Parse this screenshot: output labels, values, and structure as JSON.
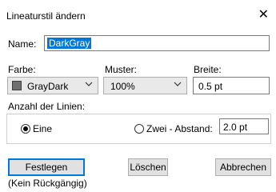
{
  "window": {
    "title": "Lineaturstil ändern",
    "close_glyph": "✕"
  },
  "name": {
    "label": "Name:",
    "value": "DarkGray"
  },
  "color": {
    "label": "Farbe:",
    "value": "GrayDark",
    "swatch": "#6f6f6f"
  },
  "pattern": {
    "label": "Muster:",
    "value": "100%"
  },
  "width": {
    "label": "Breite:",
    "value": "0.5 pt"
  },
  "lines": {
    "label": "Anzahl der Linien:",
    "option_one": "Eine",
    "option_two": "Zwei - Abstand:",
    "selected": "Eine",
    "spacing": "2.0 pt"
  },
  "buttons": {
    "apply": "Festlegen",
    "delete": "Löschen",
    "cancel": "Abbrechen"
  },
  "note": "(Kein Rückgängig)",
  "colors": {
    "accent": "#0078d7",
    "button_bg": "#e1e1e1",
    "combo_bg": "#e9e9e9"
  }
}
